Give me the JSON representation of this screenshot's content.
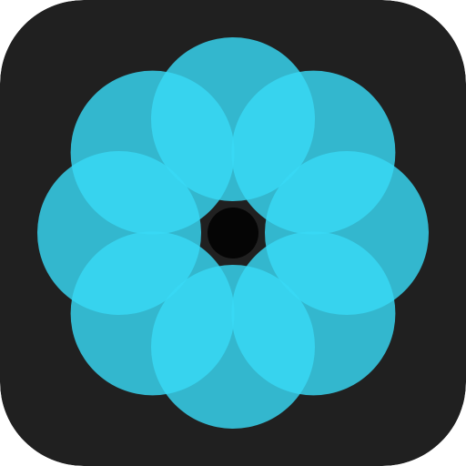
{
  "app_icon": {
    "name": "flower-ring-logo",
    "colors": {
      "tile_background": "#202020",
      "petal": "#38d9f5",
      "petal_opacity": 0.82,
      "center_hole": "#050505"
    },
    "petal_count": 8
  }
}
